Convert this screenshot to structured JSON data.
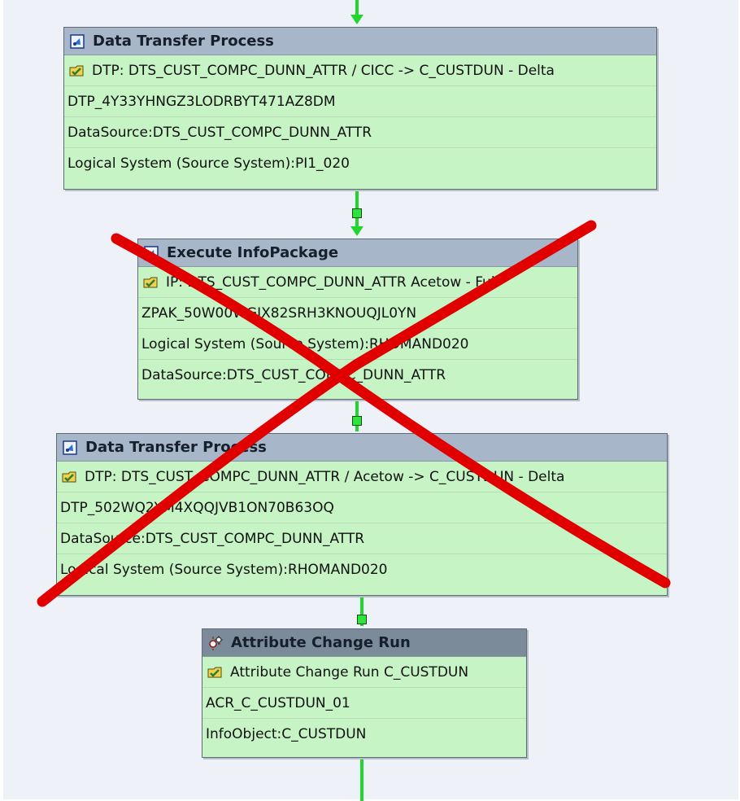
{
  "colors": {
    "connector": "#21d62d",
    "box_background": "#c7f4c5",
    "header_background": "#a7b6c8",
    "dark_header_background": "#7c8b99",
    "cross": "#e00000"
  },
  "icons": {
    "process_header": "process-icon",
    "change_run_header": "gears-icon",
    "variant": "checkmark-folder-icon"
  },
  "nodes": [
    {
      "title": "Data Transfer Process",
      "variant": "DTP: DTS_CUST_COMPC_DUNN_ATTR / CICC -> C_CUSTDUN - Delta",
      "rows": [
        "DTP_4Y33YHNGZ3LODRBYT471AZ8DM",
        "DataSource:DTS_CUST_COMPC_DUNN_ATTR",
        "Logical System (Source System):PI1_020"
      ]
    },
    {
      "title": "Execute InfoPackage",
      "variant": "IP: DTS_CUST_COMPC_DUNN_ATTR Acetow - Full",
      "rows": [
        "ZPAK_50W00WGIX82SRH3KNOUQJL0YN",
        "Logical System (Source System):RHOMAND020",
        "DataSource:DTS_CUST_COMPC_DUNN_ATTR"
      ]
    },
    {
      "title": "Data Transfer Process",
      "variant": "DTP: DTS_CUST_COMPC_DUNN_ATTR / Acetow -> C_CUSTDUN - Delta",
      "rows": [
        "DTP_502WQ2YM4XQQJVB1ON70B63OQ",
        "DataSource:DTS_CUST_COMPC_DUNN_ATTR",
        "Logical System (Source System):RHOMAND020"
      ]
    },
    {
      "title": "Attribute Change Run",
      "variant": "Attribute Change Run C_CUSTDUN",
      "rows": [
        "ACR_C_CUSTDUN_01",
        "InfoObject:C_CUSTDUN"
      ]
    }
  ]
}
